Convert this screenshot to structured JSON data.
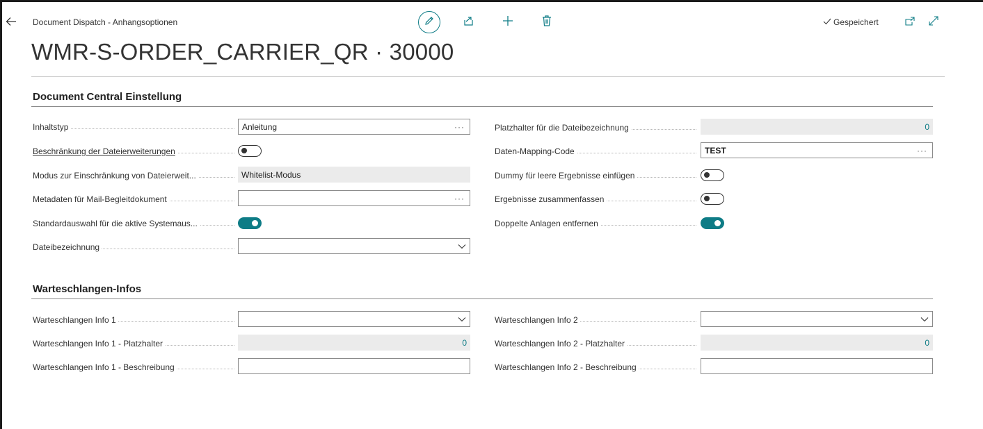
{
  "header": {
    "breadcrumb": "Document Dispatch - Anhangsoptionen",
    "title": "WMR-S-ORDER_CARRIER_QR · 30000",
    "saved_status": "Gespeichert"
  },
  "colors": {
    "accent": "#0e7c86",
    "readonly_bg": "#ebebeb"
  },
  "icons": [
    "back-arrow-icon",
    "pencil-icon",
    "share-icon",
    "plus-icon",
    "trash-icon",
    "checkmark-icon",
    "open-in-new-window-icon",
    "expand-icon"
  ],
  "section1": {
    "title": "Document Central Einstellung",
    "left": {
      "content_type": {
        "label": "Inhaltstyp",
        "value": "Anleitung"
      },
      "ext_restriction": {
        "label": "Beschränkung der Dateierweiterungen",
        "enabled": false
      },
      "restriction_mode": {
        "label": "Modus zur Einschränkung von Dateierweit...",
        "value": "Whitelist-Modus"
      },
      "mail_metadata": {
        "label": "Metadaten für Mail-Begleitdokument",
        "value": ""
      },
      "default_selection": {
        "label": "Standardauswahl für die aktive Systemaus...",
        "enabled": true
      },
      "file_name": {
        "label": "Dateibezeichnung",
        "value": ""
      }
    },
    "right": {
      "placeholder": {
        "label": "Platzhalter für die Dateibezeichnung",
        "value": "0"
      },
      "mapping_code": {
        "label": "Daten-Mapping-Code",
        "value": "TEST"
      },
      "dummy": {
        "label": "Dummy für leere Ergebnisse einfügen",
        "enabled": false
      },
      "combine": {
        "label": "Ergebnisse zusammenfassen",
        "enabled": false
      },
      "dedupe": {
        "label": "Doppelte Anlagen entfernen",
        "enabled": true
      }
    }
  },
  "section2": {
    "title": "Warteschlangen-Infos",
    "left": {
      "info": {
        "label": "Warteschlangen Info 1",
        "value": ""
      },
      "placeholder": {
        "label": "Warteschlangen Info 1 - Platzhalter",
        "value": "0"
      },
      "description": {
        "label": "Warteschlangen Info 1 - Beschreibung",
        "value": ""
      }
    },
    "right": {
      "info": {
        "label": "Warteschlangen Info 2",
        "value": ""
      },
      "placeholder": {
        "label": "Warteschlangen Info 2 - Platzhalter",
        "value": "0"
      },
      "description": {
        "label": "Warteschlangen Info 2 - Beschreibung",
        "value": ""
      }
    }
  },
  "controls": {
    "more_glyph": "···"
  }
}
